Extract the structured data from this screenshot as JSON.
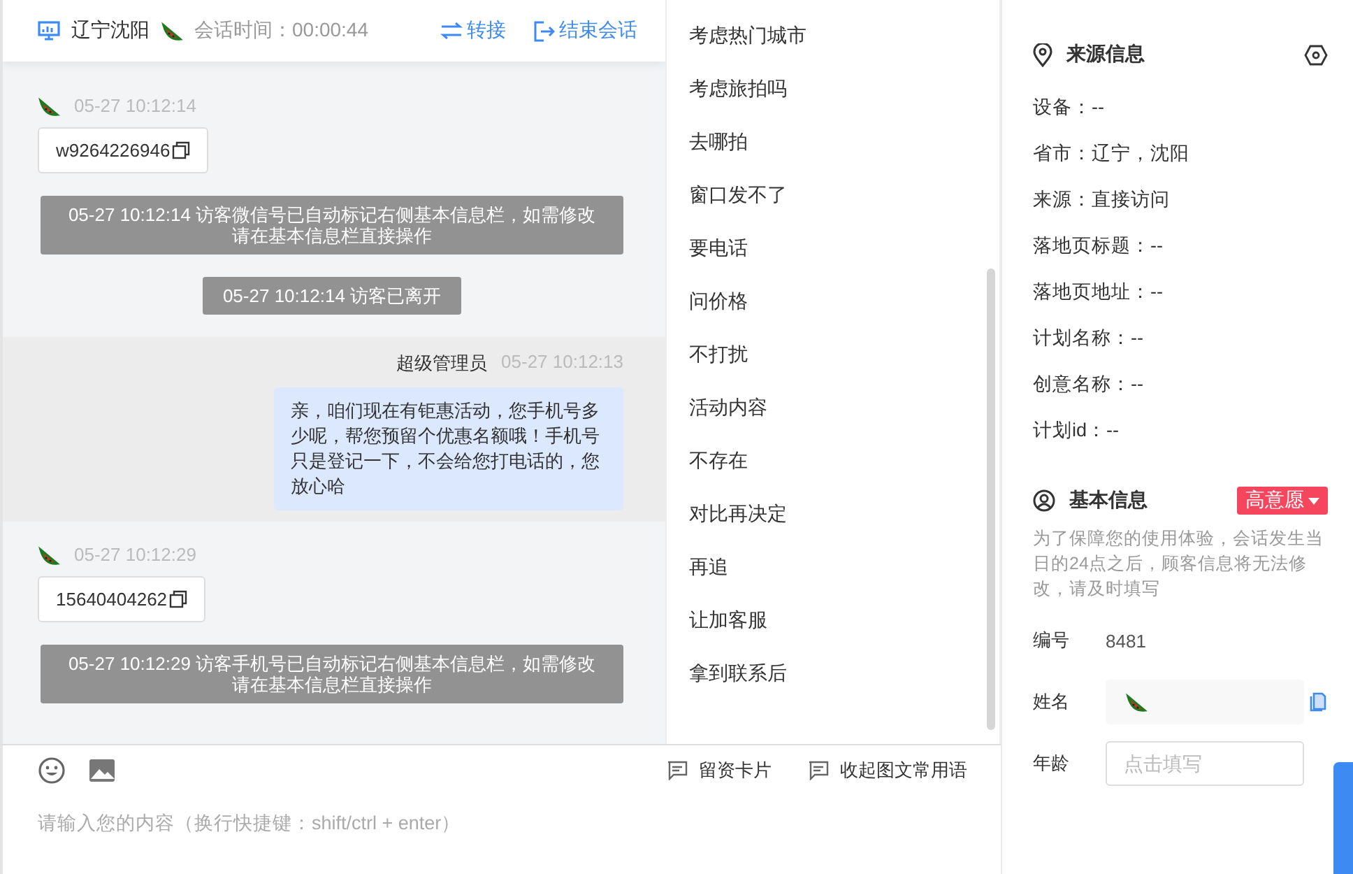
{
  "header": {
    "location": "辽宁沈阳",
    "session_time": "会话时间：00:00:44",
    "actions": [
      {
        "kind": "transfer",
        "label": "转接"
      },
      {
        "kind": "end",
        "label": "结束会话"
      }
    ]
  },
  "messages": [
    {
      "kind": "visitor",
      "time": "05-27 10:12:14",
      "text": "w9264226946"
    },
    {
      "kind": "system",
      "text": "05-27 10:12:14 访客微信号已自动标记右侧基本信息栏，如需修改请在基本信息栏直接操作"
    },
    {
      "kind": "system",
      "text": "05-27 10:12:14 访客已离开"
    },
    {
      "kind": "agent",
      "sender": "超级管理员",
      "time": "05-27 10:12:13",
      "text": "亲，咱们现在有钜惠活动，您手机号多少呢，帮您预留个优惠名额哦！手机号只是登记一下，不会给您打电话的，您放心哈"
    },
    {
      "kind": "visitor",
      "time": "05-27 10:12:29",
      "text": "15640404262"
    },
    {
      "kind": "system",
      "text": "05-27 10:12:29 访客手机号已自动标记右侧基本信息栏，如需修改请在基本信息栏直接操作"
    }
  ],
  "composer": {
    "tools": [
      {
        "kind": "emoji"
      },
      {
        "kind": "image"
      }
    ],
    "links": [
      "留资卡片",
      "收起图文常用语"
    ],
    "placeholder": "请输入您的内容（换行快捷键：shift/ctrl + enter）"
  },
  "phrases": [
    "考虑热门城市",
    "考虑旅拍吗",
    "去哪拍",
    "窗口发不了",
    "要电话",
    "问价格",
    "不打扰",
    "活动内容",
    "不存在",
    "对比再决定",
    "再追",
    "让加客服",
    "拿到联系后"
  ],
  "source_info": {
    "title": "来源信息",
    "rows": [
      "设备：--",
      "省市：辽宁，沈阳",
      "来源：直接访问",
      "落地页标题：--",
      "落地页地址：--",
      "计划名称：--",
      "创意名称：--",
      "计划id：--"
    ]
  },
  "basic_info": {
    "title": "基本信息",
    "intent": "高意愿",
    "notice": "为了保障您的使用体验，会话发生当日的24点之后，顾客信息将无法修改，请及时填写",
    "fields": [
      {
        "kind": "text",
        "label": "编号",
        "value": "8481"
      },
      {
        "kind": "name",
        "label": "姓名"
      },
      {
        "kind": "input",
        "label": "年龄",
        "placeholder": "点击填写"
      }
    ]
  }
}
